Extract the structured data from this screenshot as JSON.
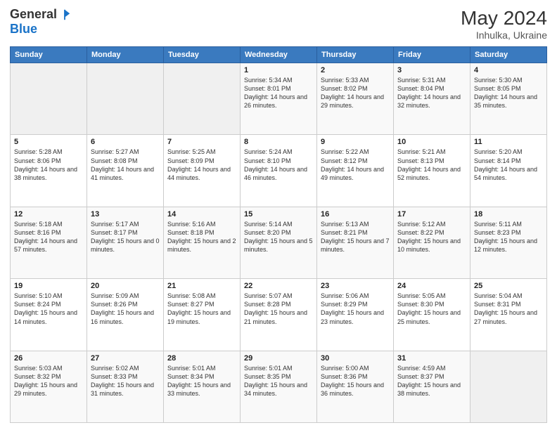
{
  "logo": {
    "general": "General",
    "blue": "Blue"
  },
  "title": "May 2024",
  "subtitle": "Inhulka, Ukraine",
  "days_of_week": [
    "Sunday",
    "Monday",
    "Tuesday",
    "Wednesday",
    "Thursday",
    "Friday",
    "Saturday"
  ],
  "weeks": [
    [
      {
        "day": "",
        "info": ""
      },
      {
        "day": "",
        "info": ""
      },
      {
        "day": "",
        "info": ""
      },
      {
        "day": "1",
        "info": "Sunrise: 5:34 AM\nSunset: 8:01 PM\nDaylight: 14 hours and 26 minutes."
      },
      {
        "day": "2",
        "info": "Sunrise: 5:33 AM\nSunset: 8:02 PM\nDaylight: 14 hours and 29 minutes."
      },
      {
        "day": "3",
        "info": "Sunrise: 5:31 AM\nSunset: 8:04 PM\nDaylight: 14 hours and 32 minutes."
      },
      {
        "day": "4",
        "info": "Sunrise: 5:30 AM\nSunset: 8:05 PM\nDaylight: 14 hours and 35 minutes."
      }
    ],
    [
      {
        "day": "5",
        "info": "Sunrise: 5:28 AM\nSunset: 8:06 PM\nDaylight: 14 hours and 38 minutes."
      },
      {
        "day": "6",
        "info": "Sunrise: 5:27 AM\nSunset: 8:08 PM\nDaylight: 14 hours and 41 minutes."
      },
      {
        "day": "7",
        "info": "Sunrise: 5:25 AM\nSunset: 8:09 PM\nDaylight: 14 hours and 44 minutes."
      },
      {
        "day": "8",
        "info": "Sunrise: 5:24 AM\nSunset: 8:10 PM\nDaylight: 14 hours and 46 minutes."
      },
      {
        "day": "9",
        "info": "Sunrise: 5:22 AM\nSunset: 8:12 PM\nDaylight: 14 hours and 49 minutes."
      },
      {
        "day": "10",
        "info": "Sunrise: 5:21 AM\nSunset: 8:13 PM\nDaylight: 14 hours and 52 minutes."
      },
      {
        "day": "11",
        "info": "Sunrise: 5:20 AM\nSunset: 8:14 PM\nDaylight: 14 hours and 54 minutes."
      }
    ],
    [
      {
        "day": "12",
        "info": "Sunrise: 5:18 AM\nSunset: 8:16 PM\nDaylight: 14 hours and 57 minutes."
      },
      {
        "day": "13",
        "info": "Sunrise: 5:17 AM\nSunset: 8:17 PM\nDaylight: 15 hours and 0 minutes."
      },
      {
        "day": "14",
        "info": "Sunrise: 5:16 AM\nSunset: 8:18 PM\nDaylight: 15 hours and 2 minutes."
      },
      {
        "day": "15",
        "info": "Sunrise: 5:14 AM\nSunset: 8:20 PM\nDaylight: 15 hours and 5 minutes."
      },
      {
        "day": "16",
        "info": "Sunrise: 5:13 AM\nSunset: 8:21 PM\nDaylight: 15 hours and 7 minutes."
      },
      {
        "day": "17",
        "info": "Sunrise: 5:12 AM\nSunset: 8:22 PM\nDaylight: 15 hours and 10 minutes."
      },
      {
        "day": "18",
        "info": "Sunrise: 5:11 AM\nSunset: 8:23 PM\nDaylight: 15 hours and 12 minutes."
      }
    ],
    [
      {
        "day": "19",
        "info": "Sunrise: 5:10 AM\nSunset: 8:24 PM\nDaylight: 15 hours and 14 minutes."
      },
      {
        "day": "20",
        "info": "Sunrise: 5:09 AM\nSunset: 8:26 PM\nDaylight: 15 hours and 16 minutes."
      },
      {
        "day": "21",
        "info": "Sunrise: 5:08 AM\nSunset: 8:27 PM\nDaylight: 15 hours and 19 minutes."
      },
      {
        "day": "22",
        "info": "Sunrise: 5:07 AM\nSunset: 8:28 PM\nDaylight: 15 hours and 21 minutes."
      },
      {
        "day": "23",
        "info": "Sunrise: 5:06 AM\nSunset: 8:29 PM\nDaylight: 15 hours and 23 minutes."
      },
      {
        "day": "24",
        "info": "Sunrise: 5:05 AM\nSunset: 8:30 PM\nDaylight: 15 hours and 25 minutes."
      },
      {
        "day": "25",
        "info": "Sunrise: 5:04 AM\nSunset: 8:31 PM\nDaylight: 15 hours and 27 minutes."
      }
    ],
    [
      {
        "day": "26",
        "info": "Sunrise: 5:03 AM\nSunset: 8:32 PM\nDaylight: 15 hours and 29 minutes."
      },
      {
        "day": "27",
        "info": "Sunrise: 5:02 AM\nSunset: 8:33 PM\nDaylight: 15 hours and 31 minutes."
      },
      {
        "day": "28",
        "info": "Sunrise: 5:01 AM\nSunset: 8:34 PM\nDaylight: 15 hours and 33 minutes."
      },
      {
        "day": "29",
        "info": "Sunrise: 5:01 AM\nSunset: 8:35 PM\nDaylight: 15 hours and 34 minutes."
      },
      {
        "day": "30",
        "info": "Sunrise: 5:00 AM\nSunset: 8:36 PM\nDaylight: 15 hours and 36 minutes."
      },
      {
        "day": "31",
        "info": "Sunrise: 4:59 AM\nSunset: 8:37 PM\nDaylight: 15 hours and 38 minutes."
      },
      {
        "day": "",
        "info": ""
      }
    ]
  ]
}
